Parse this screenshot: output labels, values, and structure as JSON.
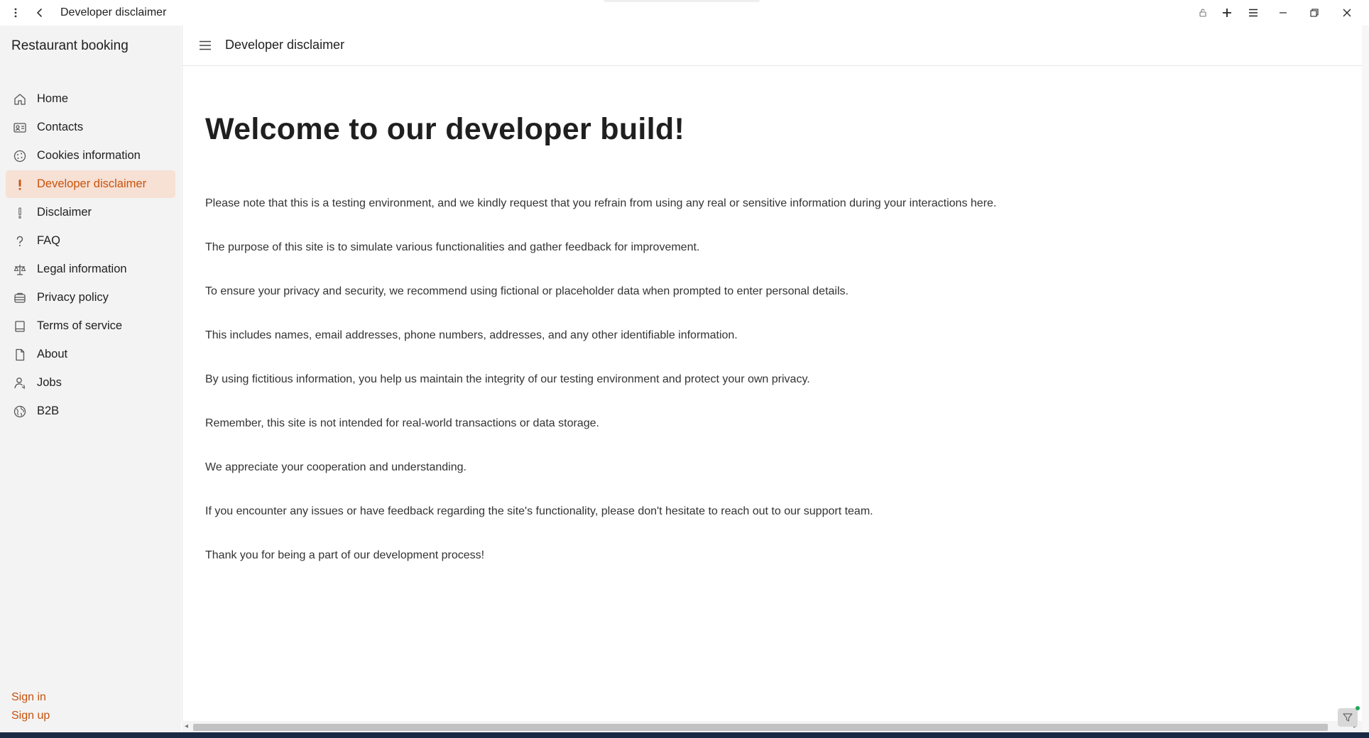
{
  "window": {
    "title": "Developer disclaimer"
  },
  "sidebar": {
    "app_title": "Restaurant booking",
    "items": [
      {
        "label": "Home",
        "icon": "home-icon"
      },
      {
        "label": "Contacts",
        "icon": "contact-card-icon"
      },
      {
        "label": "Cookies information",
        "icon": "cookie-icon"
      },
      {
        "label": "Developer disclaimer",
        "icon": "exclamation-icon",
        "active": true
      },
      {
        "label": "Disclaimer",
        "icon": "exclamation-icon"
      },
      {
        "label": "FAQ",
        "icon": "question-icon"
      },
      {
        "label": "Legal information",
        "icon": "scales-icon"
      },
      {
        "label": "Privacy policy",
        "icon": "privacy-icon"
      },
      {
        "label": "Terms of service",
        "icon": "document-icon"
      },
      {
        "label": "About",
        "icon": "page-icon"
      },
      {
        "label": "Jobs",
        "icon": "person-icon"
      },
      {
        "label": "B2B",
        "icon": "globe-icon"
      }
    ],
    "sign_in": "Sign in",
    "sign_up": "Sign up"
  },
  "header": {
    "title": "Developer disclaimer"
  },
  "main": {
    "heading": "Welcome to our developer build!",
    "paragraphs": [
      "Please note that this is a testing environment, and we kindly request that you refrain from using any real or sensitive information during your interactions here.",
      "The purpose of this site is to simulate various functionalities and gather feedback for improvement.",
      "To ensure your privacy and security, we recommend using fictional or placeholder data when prompted to enter personal details.",
      "This includes names, email addresses, phone numbers, addresses, and any other identifiable information.",
      "By using fictitious information, you help us maintain the integrity of our testing environment and protect your own privacy.",
      "Remember, this site is not intended for real-world transactions or data storage.",
      "We appreciate your cooperation and understanding.",
      "If you encounter any issues or have feedback regarding the site's functionality, please don't hesitate to reach out to our support team.",
      "Thank you for being a part of our development process!"
    ]
  },
  "colors": {
    "accent": "#c8520c",
    "active_bg": "#f7e0d4",
    "sidebar_bg": "#f3f3f3"
  }
}
